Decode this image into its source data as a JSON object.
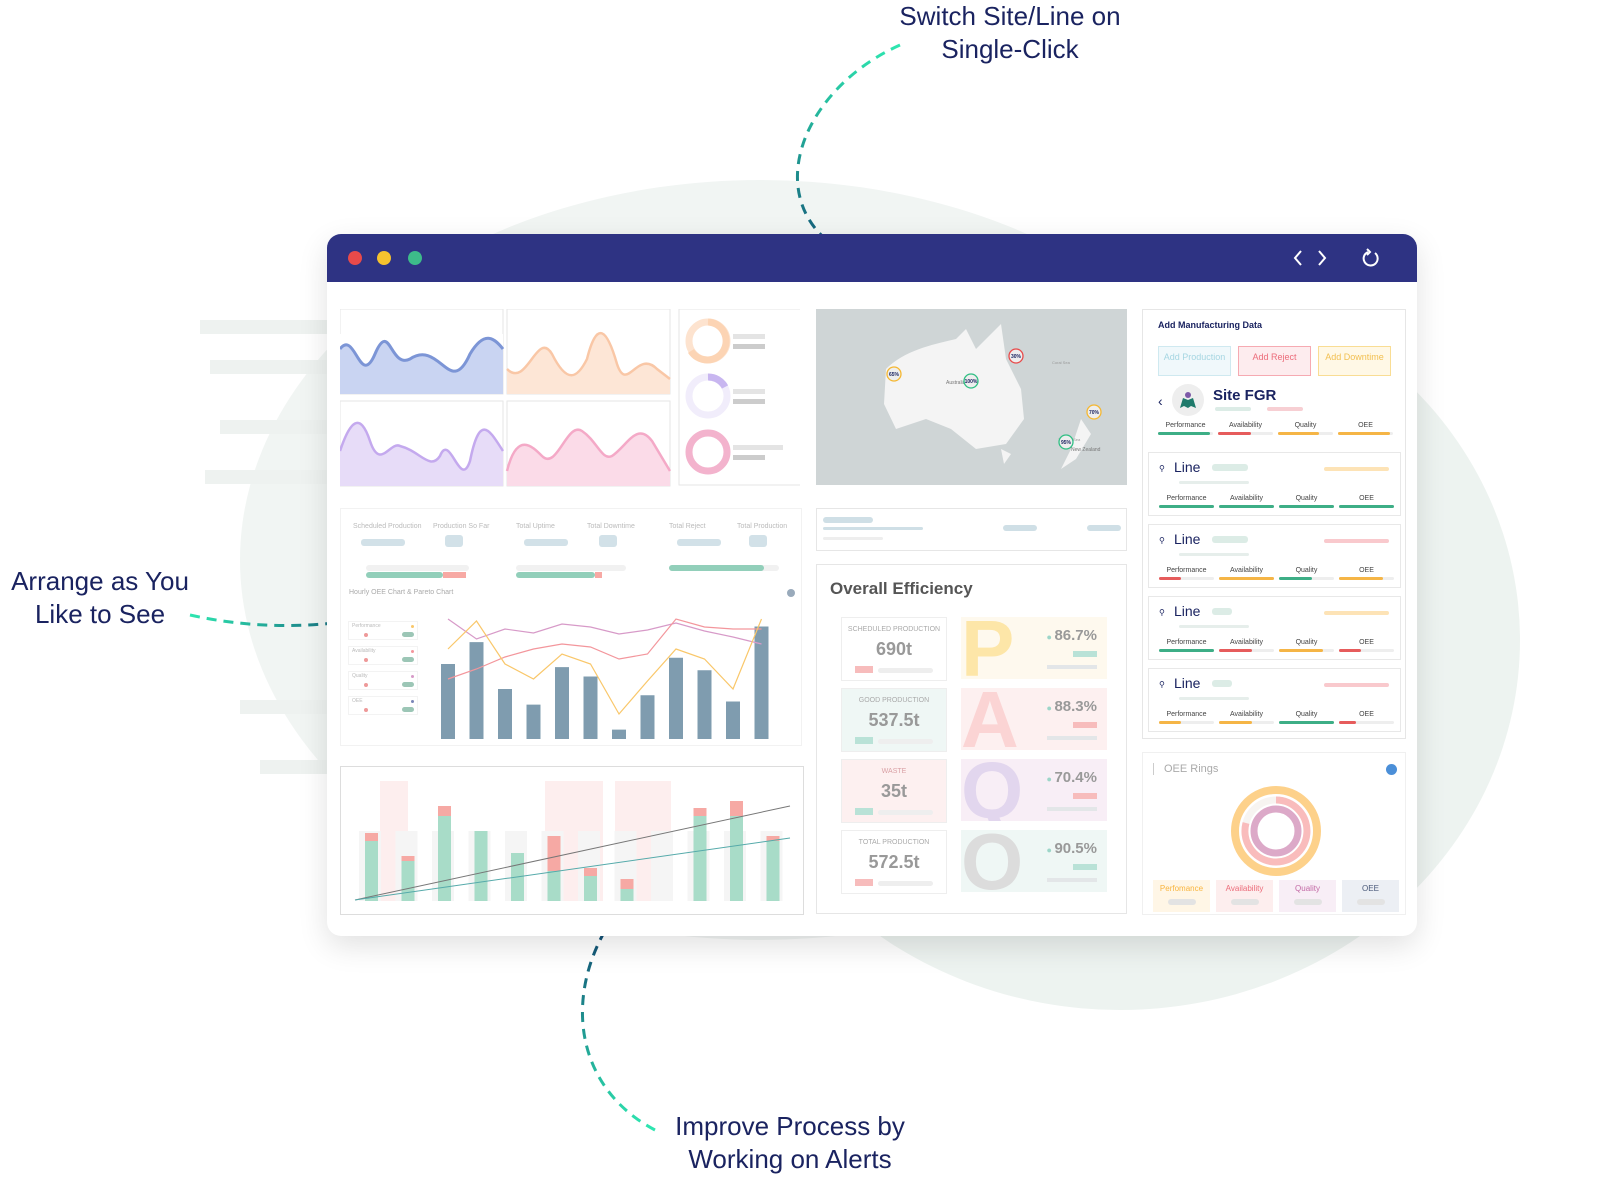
{
  "callouts": {
    "switch": "Switch Site/Line on Single-Click",
    "arrange": "Arrange as You Like to See",
    "improve": "Improve Process by Working on Alerts"
  },
  "window": {
    "icons": [
      "chevron-left-icon",
      "chevron-right-icon",
      "refresh-icon"
    ]
  },
  "summary": {
    "labels": [
      "Scheduled Production",
      "Production So Far",
      "Total Uptime",
      "Total Downtime",
      "Total Reject",
      "Total Production"
    ]
  },
  "hourly": {
    "title": "Hourly OEE Chart & Pareto Chart",
    "legend": [
      "Performance",
      "Availability",
      "Quality",
      "OEE"
    ],
    "bars": [
      24,
      31,
      16,
      11,
      23,
      20,
      3,
      14,
      26,
      22,
      12,
      36
    ]
  },
  "map": {
    "markers": [
      {
        "label": "65%",
        "color": "#f5b731"
      },
      {
        "label": "100%",
        "color": "#2fbf83"
      },
      {
        "label": "30%",
        "color": "#e84a4a"
      },
      {
        "label": "70%",
        "color": "#f5b731"
      },
      {
        "label": "95%",
        "color": "#2fbf83"
      }
    ],
    "places": [
      "Australia",
      "New Zealand",
      "Coral Sea",
      "Tasman Sea"
    ]
  },
  "efficiency": {
    "title": "Overall Efficiency",
    "items": [
      {
        "label": "SCHEDULED PRODUCTION",
        "value": "690t",
        "letter": "P",
        "pct": "86.7%"
      },
      {
        "label": "GOOD PRODUCTION",
        "value": "537.5t",
        "letter": "A",
        "pct": "88.3%"
      },
      {
        "label": "WASTE",
        "value": "35t",
        "letter": "Q",
        "pct": "70.4%"
      },
      {
        "label": "TOTAL PRODUCTION",
        "value": "572.5t",
        "letter": "O",
        "pct": "90.5%"
      }
    ]
  },
  "manufacturing": {
    "title": "Add Manufacturing Data",
    "buttons": [
      "Add Production",
      "Add Reject",
      "Add Downtime"
    ],
    "site": "Site FGR",
    "metrics": [
      "Performance",
      "Availability",
      "Quality",
      "OEE"
    ],
    "lines": [
      "Line",
      "Line",
      "Line",
      "Line"
    ]
  },
  "rings": {
    "title": "OEE Rings",
    "legend": [
      "Perfomance",
      "Availability",
      "Quality",
      "OEE"
    ]
  },
  "colors": {
    "titlebar": "#2e3383",
    "callout": "#1a2360",
    "accent_teal": "#2ee6b0"
  }
}
